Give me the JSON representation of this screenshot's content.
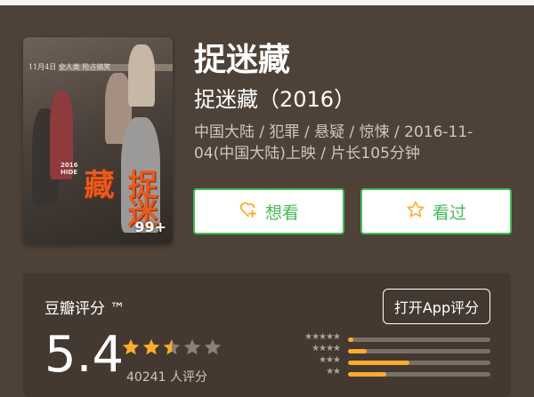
{
  "poster": {
    "date_line": "11月4日 全人类 险占搞笑",
    "title_art": "捉迷藏",
    "side_text": "2016 HIDE",
    "badge": "99+"
  },
  "movie": {
    "title": "捉迷藏",
    "subtitle": "捉迷藏（2016）",
    "meta": "中国大陆 / 犯罪 / 悬疑 / 惊悚 / 2016-11-04(中国大陆)上映 / 片长105分钟"
  },
  "actions": {
    "want_label": "想看",
    "want_icon": "heart-plus-icon",
    "seen_label": "看过",
    "seen_icon": "star-outline-icon"
  },
  "rating": {
    "label": "豆瓣评分 ™",
    "app_button": "打开App评分",
    "score": "5.4",
    "stars": 2.5,
    "count_text": "40241 人评分",
    "distribution": [
      {
        "stars": "★★★★★",
        "fraction": 0.04
      },
      {
        "stars": "★★★★",
        "fraction": 0.13
      },
      {
        "stars": "★★★",
        "fraction": 0.43
      },
      {
        "stars": "★★",
        "fraction": 0.27
      }
    ]
  },
  "colors": {
    "background": "#4e4238",
    "accent_green": "#42bd56",
    "star_gold": "#ffac2d"
  }
}
